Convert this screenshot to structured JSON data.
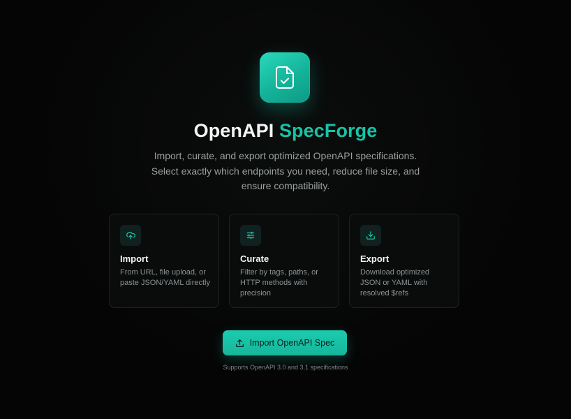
{
  "hero": {
    "logo_icon": "file-check-icon",
    "title_part1": "OpenAPI",
    "title_part2": "SpecForge",
    "subtitle": "Import, curate, and export optimized OpenAPI specifications. Select exactly which endpoints you need, reduce file size, and ensure compatibility.",
    "accent_color": "#18c2a5"
  },
  "features": [
    {
      "icon": "cloud-upload-icon",
      "title": "Import",
      "description": "From URL, file upload, or paste JSON/YAML directly"
    },
    {
      "icon": "sliders-icon",
      "title": "Curate",
      "description": "Filter by tags, paths, or HTTP methods with precision"
    },
    {
      "icon": "download-icon",
      "title": "Export",
      "description": "Download optimized JSON or YAML with resolved $refs"
    }
  ],
  "cta": {
    "icon": "upload-icon",
    "label": "Import OpenAPI Spec"
  },
  "footnote": "Supports OpenAPI 3.0 and 3.1 specifications"
}
